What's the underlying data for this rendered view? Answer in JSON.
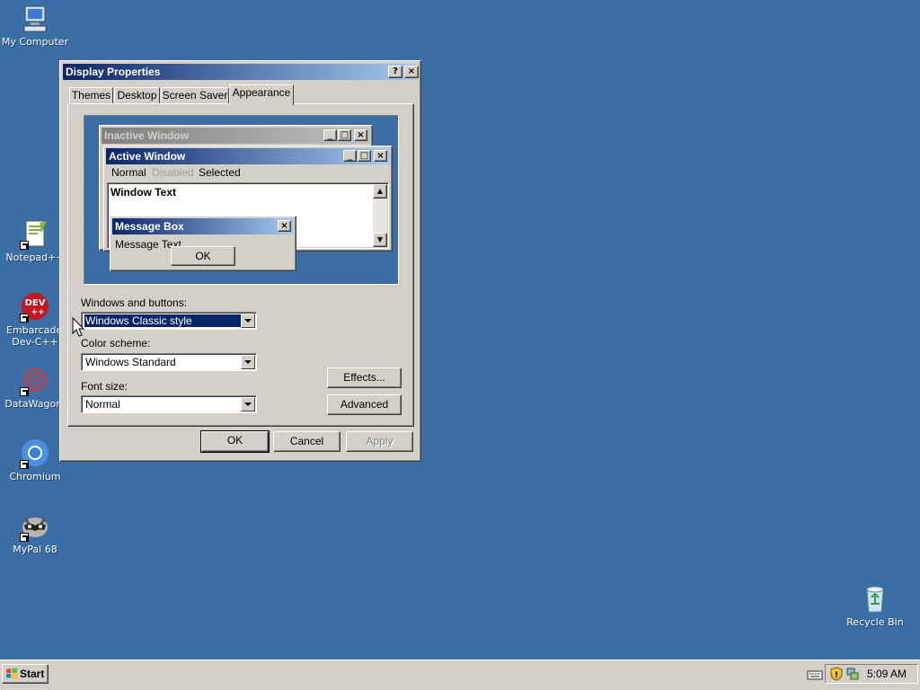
{
  "desktop": {
    "icons": [
      {
        "label": "My Computer"
      },
      {
        "label": "Notepad++"
      },
      {
        "label": "Embarcadero Dev-C++"
      },
      {
        "label": "DataWagon."
      },
      {
        "label": "Chromium"
      },
      {
        "label": "MyPal 68"
      },
      {
        "label": "Recycle Bin"
      }
    ]
  },
  "dialog": {
    "title": "Display Properties",
    "help_btn": "?",
    "close_btn": "×",
    "tabs": [
      "Themes",
      "Desktop",
      "Screen Saver",
      "Appearance"
    ],
    "active_tab": "Appearance",
    "preview": {
      "inactive_title": "Inactive Window",
      "active_title": "Active Window",
      "menu": [
        "Normal",
        "Disabled",
        "Selected"
      ],
      "window_text": "Window Text",
      "msgbox_title": "Message Box",
      "msgbox_text": "Message Text",
      "msgbox_ok": "OK"
    },
    "windows_buttons_label": "Windows and buttons:",
    "windows_buttons_value": "Windows Classic style",
    "color_scheme_label": "Color scheme:",
    "color_scheme_value": "Windows Standard",
    "font_size_label": "Font size:",
    "font_size_value": "Normal",
    "effects_btn": "Effects...",
    "advanced_btn": "Advanced",
    "ok_btn": "OK",
    "cancel_btn": "Cancel",
    "apply_btn": "Apply"
  },
  "taskbar": {
    "start_label": "Start",
    "clock": "5:09 AM"
  },
  "colors": {
    "desktop": "#3a6ea5",
    "face": "#d4d0c8",
    "active_title_start": "#0a246a",
    "active_title_end": "#a6caf0",
    "inactive_title_start": "#808080",
    "inactive_title_end": "#c0c0c0"
  }
}
